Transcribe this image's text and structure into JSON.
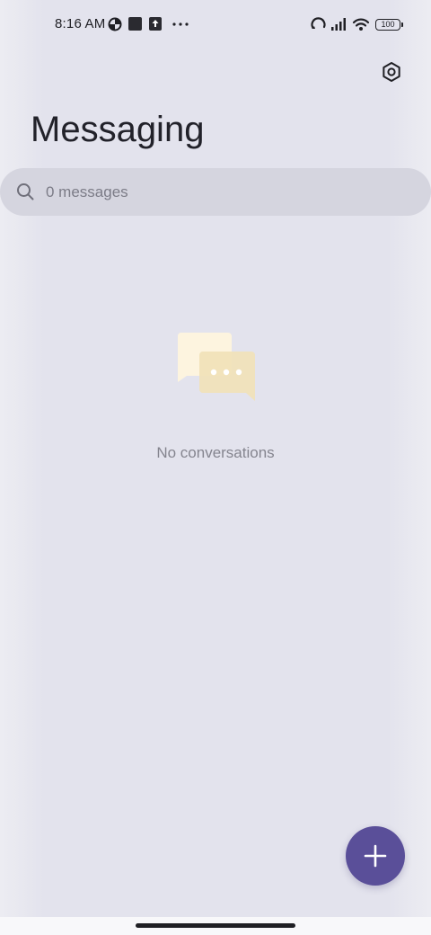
{
  "status_bar": {
    "time": "8:16 AM",
    "battery": "100",
    "left_icons": [
      "data-saver-icon",
      "square-app-icon",
      "upload-icon",
      "more-dots-icon"
    ],
    "right_icons": [
      "hotspot-icon",
      "signal-icon",
      "wifi-icon",
      "battery-icon"
    ]
  },
  "header": {
    "title": "Messaging",
    "settings_icon": "settings-icon"
  },
  "search": {
    "placeholder": "0 messages",
    "icon": "search-icon"
  },
  "empty_state": {
    "icon": "chat-bubbles-icon",
    "text": "No conversations"
  },
  "fab": {
    "icon": "plus-icon",
    "color": "#5a4f99"
  },
  "colors": {
    "background": "#e3e3ed",
    "search_bg": "#d5d5df",
    "accent": "#5a4f99",
    "bubble_light": "#fdf4df",
    "bubble_dark": "#f0dfb4"
  }
}
